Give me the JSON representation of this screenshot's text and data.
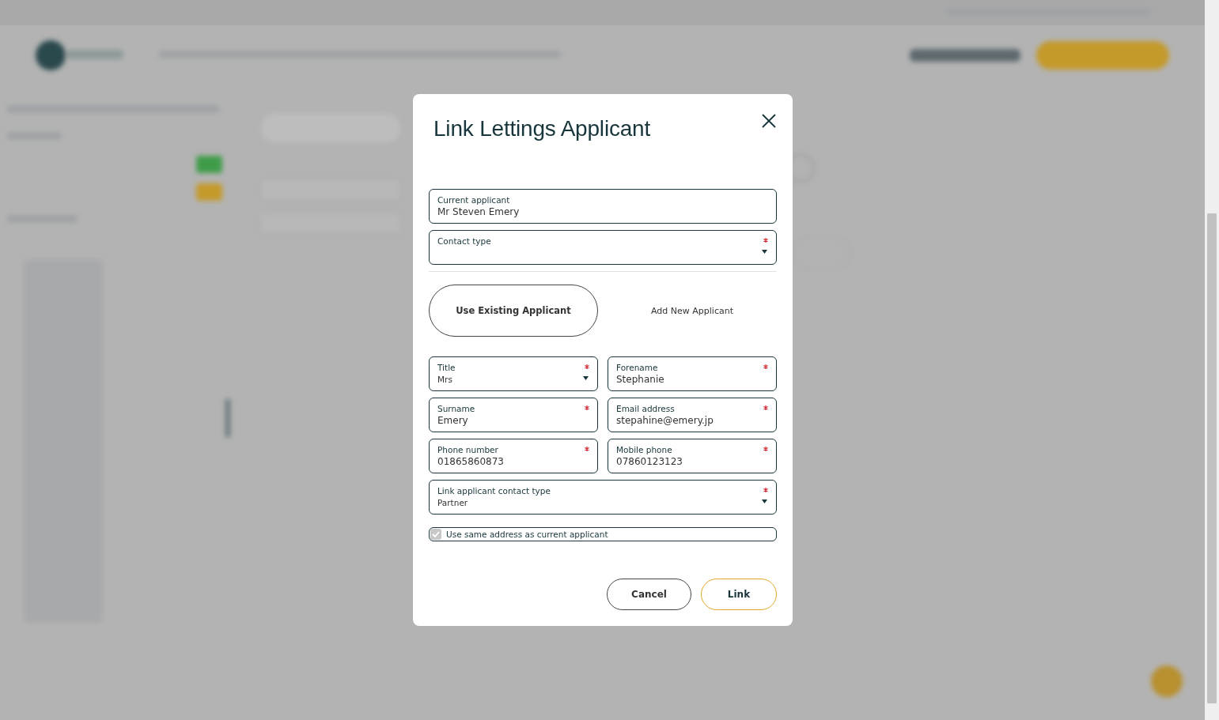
{
  "dialog": {
    "title": "Link Lettings Applicant",
    "top_fields": [
      {
        "label": "Current applicant",
        "value": "Mr Steven Emery",
        "kind": "text",
        "required": false
      },
      {
        "label": "Contact type",
        "kind": "select",
        "required": true
      }
    ],
    "mode_toggle": [
      {
        "label": "Use Existing Applicant",
        "selected": true
      },
      {
        "label": "Add New Applicant",
        "selected": false
      }
    ],
    "form_fields": [
      {
        "label": "Title",
        "value": "Mrs",
        "kind": "select",
        "required": true,
        "wide": false
      },
      {
        "label": "Forename",
        "value": "Stephanie",
        "kind": "text",
        "required": true,
        "wide": false
      },
      {
        "label": "Surname",
        "value": "Emery",
        "kind": "text",
        "required": true,
        "wide": false
      },
      {
        "label": "Email address",
        "value": "stepahine@emery.jp",
        "kind": "text",
        "required": true,
        "wide": false
      },
      {
        "label": "Phone number",
        "value": "01865860873",
        "kind": "text",
        "required": true,
        "wide": false
      },
      {
        "label": "Mobile phone",
        "value": "07860123123",
        "kind": "text",
        "required": true,
        "wide": false
      },
      {
        "label": "Link applicant contact type",
        "value": "Partner",
        "kind": "select",
        "required": true,
        "wide": true
      }
    ],
    "same_address": {
      "label": "Use same address as current applicant",
      "checked": true,
      "disabled": true
    },
    "buttons": [
      {
        "label": "Cancel",
        "kind": "secondary"
      },
      {
        "label": "Link",
        "kind": "primary"
      }
    ]
  }
}
